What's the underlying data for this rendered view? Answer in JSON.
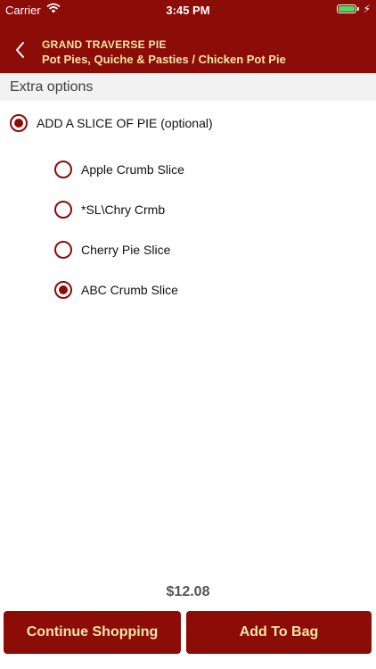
{
  "status_bar": {
    "carrier": "Carrier",
    "time": "3:45 PM",
    "battery_color": "#4cd964"
  },
  "header": {
    "restaurant": "GRAND TRAVERSE PIE",
    "breadcrumb": "Pot Pies, Quiche & Pasties / Chicken Pot Pie",
    "back_icon": "chevron-left-icon",
    "background_color": "#8c0c08",
    "text_color": "#f3e6a6"
  },
  "section": {
    "title": "Extra options"
  },
  "group": {
    "label": "ADD A SLICE OF PIE (optional)",
    "selected": true
  },
  "options": [
    {
      "label": "Apple Crumb Slice",
      "selected": false
    },
    {
      "label": "*SL\\Chry Crmb",
      "selected": false
    },
    {
      "label": "Cherry Pie Slice",
      "selected": false
    },
    {
      "label": "ABC Crumb Slice",
      "selected": true
    }
  ],
  "price": "$12.08",
  "buttons": {
    "continue": "Continue Shopping",
    "add": "Add To Bag"
  }
}
